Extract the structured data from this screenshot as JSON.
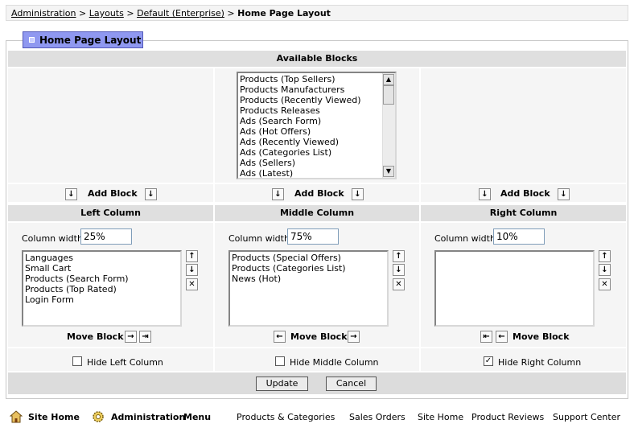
{
  "breadcrumb": {
    "items": [
      "Administration",
      "Layouts",
      "Default (Enterprise)"
    ],
    "current": "Home Page Layout",
    "separator": ">"
  },
  "page_title": "Home Page Layout",
  "available": {
    "header": "Available Blocks",
    "items": [
      "Products (Top Sellers)",
      "Products Manufacturers",
      "Products (Recently Viewed)",
      "Products Releases",
      "Ads (Search Form)",
      "Ads (Hot Offers)",
      "Ads (Recently Viewed)",
      "Ads (Categories List)",
      "Ads (Sellers)",
      "Ads (Latest)"
    ]
  },
  "add_block_label": "Add Block",
  "move_block_label": "Move Block",
  "column_width_label": "Column width",
  "columns": {
    "left": {
      "header": "Left Column",
      "width": "25%",
      "items": [
        "Languages",
        "Small Cart",
        "Products (Search Form)",
        "Products (Top Rated)",
        "Login Form"
      ],
      "hide_label": "Hide Left Column",
      "hidden": false
    },
    "middle": {
      "header": "Middle Column",
      "width": "75%",
      "items": [
        "Products (Special Offers)",
        "Products (Categories List)",
        "News (Hot)"
      ],
      "hide_label": "Hide Middle Column",
      "hidden": false
    },
    "right": {
      "header": "Right Column",
      "width": "10%",
      "items": [],
      "hide_label": "Hide Right Column",
      "hidden": true
    }
  },
  "buttons": {
    "update": "Update",
    "cancel": "Cancel"
  },
  "footer": {
    "site_home": "Site Home",
    "administration": "Administration",
    "menu": "Menu",
    "links": [
      "Products & Categories",
      "Sales Orders",
      "Site Home",
      "Product Reviews",
      "Support Center"
    ]
  },
  "icons": {
    "add": "arrow-down-icon",
    "up": "arrow-up-icon",
    "remove": "close-icon",
    "right": "arrow-right-icon",
    "left": "arrow-left-icon",
    "home": "home-icon",
    "admin": "gear-icon"
  },
  "colors": {
    "title_tab": "#8f98f0",
    "header_bg": "#dfdfdf",
    "cell_bg": "#f5f5f5"
  }
}
